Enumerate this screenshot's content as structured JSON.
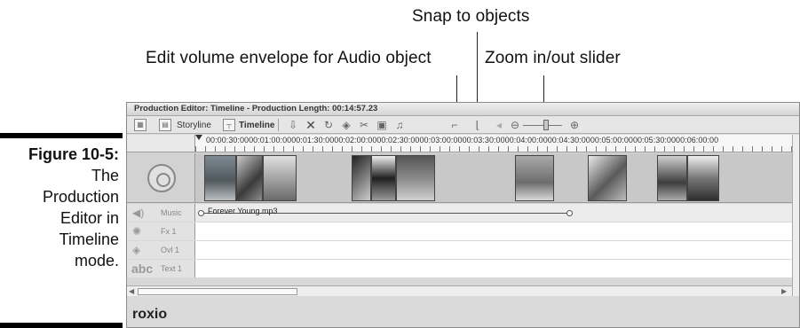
{
  "callouts": {
    "snap": "Snap to objects",
    "volume": "Edit volume envelope for Audio object",
    "zoom": "Zoom in/out slider"
  },
  "caption": {
    "figure": "Figure 10-5:",
    "lines": [
      "The",
      "Production",
      "Editor in",
      "Timeline",
      "mode."
    ]
  },
  "window": {
    "title": "Production Editor: Timeline - Production Length: 00:14:57.23",
    "toolbar": {
      "storyline_label": "Storyline",
      "timeline_label": "Timeline"
    },
    "ruler_times": "00:00:30:0000:01:00:0000:01:30:0000:02:00:0000:02:30:0000:03:00:0000:03:30:0000:04:00:0000:04:30:0000:05:00:0000:05:30:0000:06:00:00",
    "tracks": {
      "music": "Music",
      "fx": "Fx 1",
      "overlay": "Ovl 1",
      "text_icon": "abc",
      "text": "Text 1"
    },
    "audio_clip": "Forever Young.mp3",
    "logo": "roxio"
  }
}
